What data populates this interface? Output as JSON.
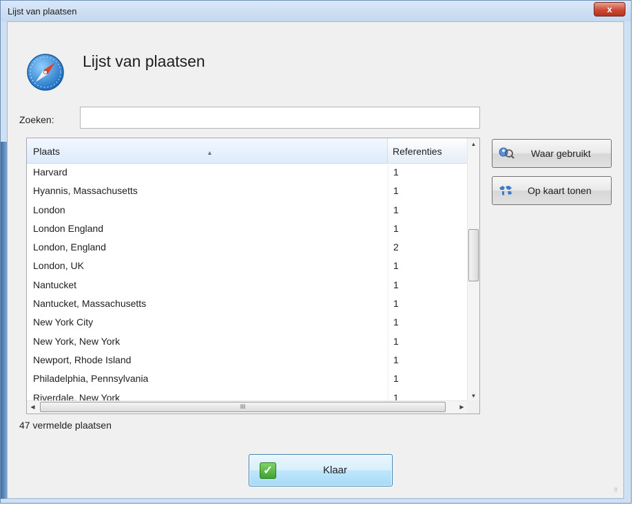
{
  "window": {
    "title": "Lijst van plaatsen",
    "close_label": "x"
  },
  "dialog": {
    "heading": "Lijst van plaatsen",
    "icon": "compass-icon",
    "search": {
      "label": "Zoeken:",
      "value": "",
      "placeholder": ""
    },
    "table": {
      "columns": [
        "Plaats",
        "Referenties"
      ],
      "sort_column": "Plaats",
      "rows": [
        {
          "place": "Harvard",
          "refs": "1"
        },
        {
          "place": "Hyannis, Massachusetts",
          "refs": "1"
        },
        {
          "place": "London",
          "refs": "1"
        },
        {
          "place": "London England",
          "refs": "1"
        },
        {
          "place": "London, England",
          "refs": "2"
        },
        {
          "place": "London, UK",
          "refs": "1"
        },
        {
          "place": "Nantucket",
          "refs": "1"
        },
        {
          "place": "Nantucket, Massachusetts",
          "refs": "1"
        },
        {
          "place": "New York City",
          "refs": "1"
        },
        {
          "place": "New York, New York",
          "refs": "1"
        },
        {
          "place": "Newport, Rhode Island",
          "refs": "1"
        },
        {
          "place": "Philadelphia, Pennsylvania",
          "refs": "1"
        },
        {
          "place": "Riverdale, New York",
          "refs": "1"
        }
      ],
      "hscroll_grip": "III"
    },
    "buttons": {
      "where_used": {
        "label": "Waar gebruikt",
        "icon": "search-people-icon"
      },
      "show_on_map": {
        "label": "Op kaart tonen",
        "icon": "world-map-icon"
      },
      "done": {
        "label": "Klaar",
        "icon": "checkmark-icon"
      }
    },
    "status": "47 vermelde plaatsen"
  },
  "colors": {
    "accent": "#3c7fb1",
    "header_sorted": "#dcebfb",
    "close": "#cc4a35"
  }
}
